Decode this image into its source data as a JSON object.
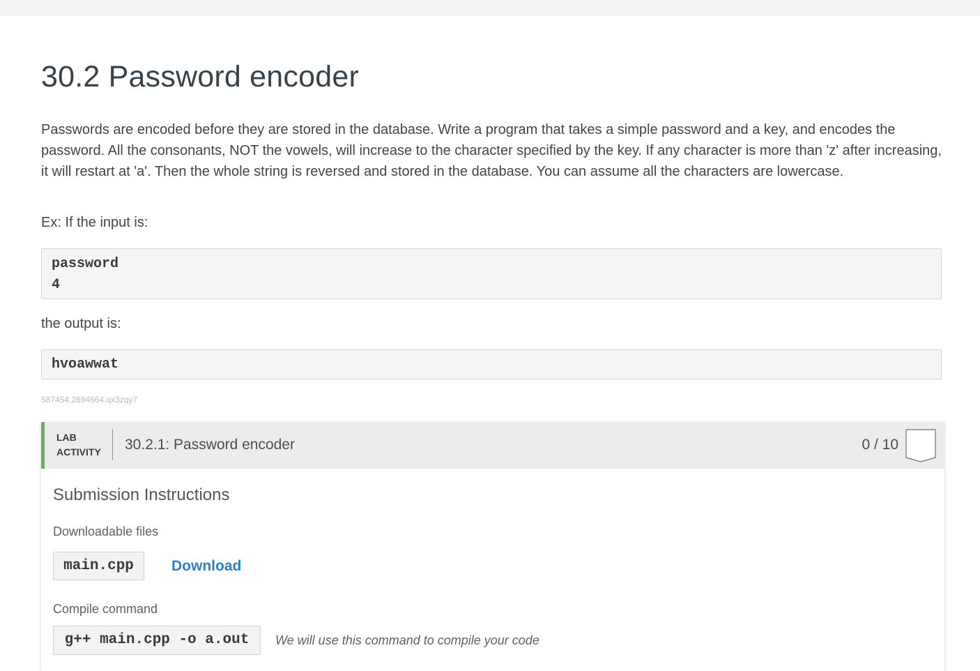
{
  "section": {
    "title": "30.2 Password encoder",
    "description": "Passwords are encoded before they are stored in the database. Write a program that takes a simple password and a key, and encodes the password. All the consonants, NOT the vowels, will increase to the character specified by the key. If any character is more than 'z' after increasing, it will restart at 'a'. Then the whole string is reversed and stored in the database. You can assume all the characters are lowercase.",
    "example_intro": "Ex: If the input is:",
    "example_input": [
      "password",
      "4"
    ],
    "output_intro": "the output is:",
    "example_output": "hvoawwat",
    "reference_id": "587454.2894664.qx3zqy7"
  },
  "lab": {
    "kind_line1": "LAB",
    "kind_line2": "ACTIVITY",
    "title": "30.2.1: Password encoder",
    "score": "0 / 10",
    "accent_color": "#6fad5c",
    "submission_title": "Submission Instructions",
    "files_label": "Downloadable files",
    "file_name": "main.cpp",
    "download_label": "Download",
    "compile_label": "Compile command",
    "compile_command": "g++ main.cpp -o a.out",
    "compile_note": "We will use this command to compile your code"
  }
}
